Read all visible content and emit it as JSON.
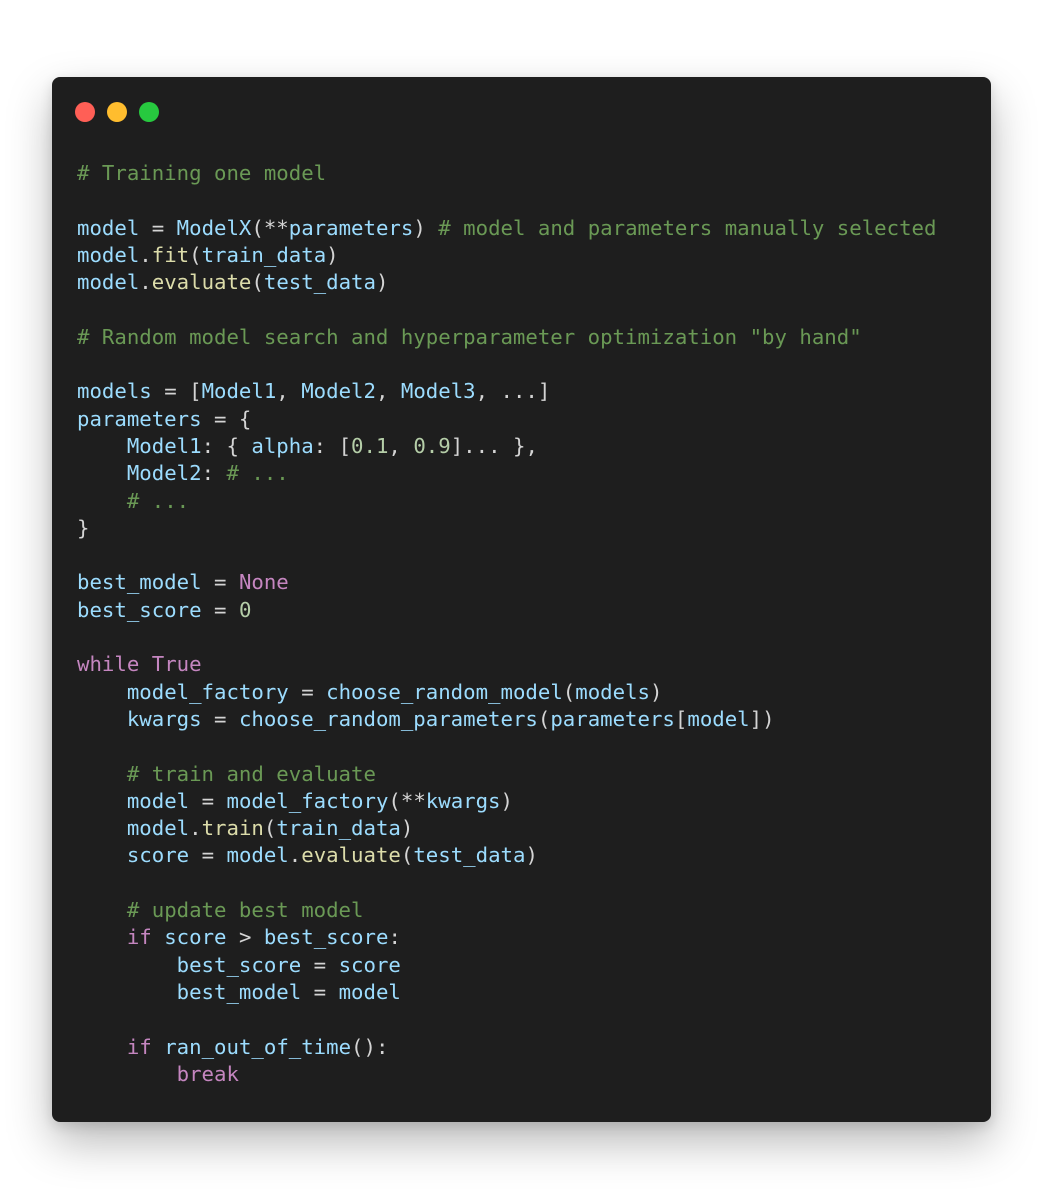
{
  "window": {
    "controls": [
      {
        "name": "close",
        "color": "#FF5F56"
      },
      {
        "name": "minimize",
        "color": "#FFBD2E"
      },
      {
        "name": "maximize",
        "color": "#27C93F"
      }
    ]
  },
  "code": {
    "language": "python",
    "lines": [
      [
        [
          "comment",
          "# Training one model"
        ]
      ],
      [],
      [
        [
          "var",
          "model"
        ],
        [
          "op",
          " = "
        ],
        [
          "var",
          "ModelX"
        ],
        [
          "op",
          "(**"
        ],
        [
          "var",
          "parameters"
        ],
        [
          "op",
          ") "
        ],
        [
          "comment",
          "# model and parameters manually selected"
        ]
      ],
      [
        [
          "var",
          "model"
        ],
        [
          "op",
          "."
        ],
        [
          "fn",
          "fit"
        ],
        [
          "op",
          "("
        ],
        [
          "var",
          "train_data"
        ],
        [
          "op",
          ")"
        ]
      ],
      [
        [
          "var",
          "model"
        ],
        [
          "op",
          "."
        ],
        [
          "fn",
          "evaluate"
        ],
        [
          "op",
          "("
        ],
        [
          "var",
          "test_data"
        ],
        [
          "op",
          ")"
        ]
      ],
      [],
      [
        [
          "comment",
          "# Random model search and hyperparameter optimization \"by hand\""
        ]
      ],
      [],
      [
        [
          "var",
          "models"
        ],
        [
          "op",
          " = ["
        ],
        [
          "var",
          "Model1"
        ],
        [
          "op",
          ", "
        ],
        [
          "var",
          "Model2"
        ],
        [
          "op",
          ", "
        ],
        [
          "var",
          "Model3"
        ],
        [
          "op",
          ", ...]"
        ]
      ],
      [
        [
          "var",
          "parameters"
        ],
        [
          "op",
          " = {"
        ]
      ],
      [
        [
          "op",
          "    "
        ],
        [
          "var",
          "Model1"
        ],
        [
          "op",
          ": { "
        ],
        [
          "var",
          "alpha"
        ],
        [
          "op",
          ": ["
        ],
        [
          "num",
          "0.1"
        ],
        [
          "op",
          ", "
        ],
        [
          "num",
          "0.9"
        ],
        [
          "op",
          "]... },"
        ]
      ],
      [
        [
          "op",
          "    "
        ],
        [
          "var",
          "Model2"
        ],
        [
          "op",
          ": "
        ],
        [
          "comment",
          "# ..."
        ]
      ],
      [
        [
          "op",
          "    "
        ],
        [
          "comment",
          "# ..."
        ]
      ],
      [
        [
          "op",
          "}"
        ]
      ],
      [],
      [
        [
          "var",
          "best_model"
        ],
        [
          "op",
          " = "
        ],
        [
          "kw",
          "None"
        ]
      ],
      [
        [
          "var",
          "best_score"
        ],
        [
          "op",
          " = "
        ],
        [
          "num",
          "0"
        ]
      ],
      [],
      [
        [
          "kw",
          "while"
        ],
        [
          "op",
          " "
        ],
        [
          "kw",
          "True"
        ]
      ],
      [
        [
          "op",
          "    "
        ],
        [
          "var",
          "model_factory"
        ],
        [
          "op",
          " = "
        ],
        [
          "var",
          "choose_random_model"
        ],
        [
          "op",
          "("
        ],
        [
          "var",
          "models"
        ],
        [
          "op",
          ")"
        ]
      ],
      [
        [
          "op",
          "    "
        ],
        [
          "var",
          "kwargs"
        ],
        [
          "op",
          " = "
        ],
        [
          "var",
          "choose_random_parameters"
        ],
        [
          "op",
          "("
        ],
        [
          "var",
          "parameters"
        ],
        [
          "op",
          "["
        ],
        [
          "var",
          "model"
        ],
        [
          "op",
          "])"
        ]
      ],
      [],
      [
        [
          "op",
          "    "
        ],
        [
          "comment",
          "# train and evaluate"
        ]
      ],
      [
        [
          "op",
          "    "
        ],
        [
          "var",
          "model"
        ],
        [
          "op",
          " = "
        ],
        [
          "var",
          "model_factory"
        ],
        [
          "op",
          "(**"
        ],
        [
          "var",
          "kwargs"
        ],
        [
          "op",
          ")"
        ]
      ],
      [
        [
          "op",
          "    "
        ],
        [
          "var",
          "model"
        ],
        [
          "op",
          "."
        ],
        [
          "fn",
          "train"
        ],
        [
          "op",
          "("
        ],
        [
          "var",
          "train_data"
        ],
        [
          "op",
          ")"
        ]
      ],
      [
        [
          "op",
          "    "
        ],
        [
          "var",
          "score"
        ],
        [
          "op",
          " = "
        ],
        [
          "var",
          "model"
        ],
        [
          "op",
          "."
        ],
        [
          "fn",
          "evaluate"
        ],
        [
          "op",
          "("
        ],
        [
          "var",
          "test_data"
        ],
        [
          "op",
          ")"
        ]
      ],
      [],
      [
        [
          "op",
          "    "
        ],
        [
          "comment",
          "# update best model"
        ]
      ],
      [
        [
          "op",
          "    "
        ],
        [
          "kw",
          "if"
        ],
        [
          "op",
          " "
        ],
        [
          "var",
          "score"
        ],
        [
          "op",
          " > "
        ],
        [
          "var",
          "best_score"
        ],
        [
          "op",
          ":"
        ]
      ],
      [
        [
          "op",
          "        "
        ],
        [
          "var",
          "best_score"
        ],
        [
          "op",
          " = "
        ],
        [
          "var",
          "score"
        ]
      ],
      [
        [
          "op",
          "        "
        ],
        [
          "var",
          "best_model"
        ],
        [
          "op",
          " = "
        ],
        [
          "var",
          "model"
        ]
      ],
      [],
      [
        [
          "op",
          "    "
        ],
        [
          "kw",
          "if"
        ],
        [
          "op",
          " "
        ],
        [
          "var",
          "ran_out_of_time"
        ],
        [
          "op",
          "():"
        ]
      ],
      [
        [
          "op",
          "        "
        ],
        [
          "kw",
          "break"
        ]
      ]
    ]
  }
}
